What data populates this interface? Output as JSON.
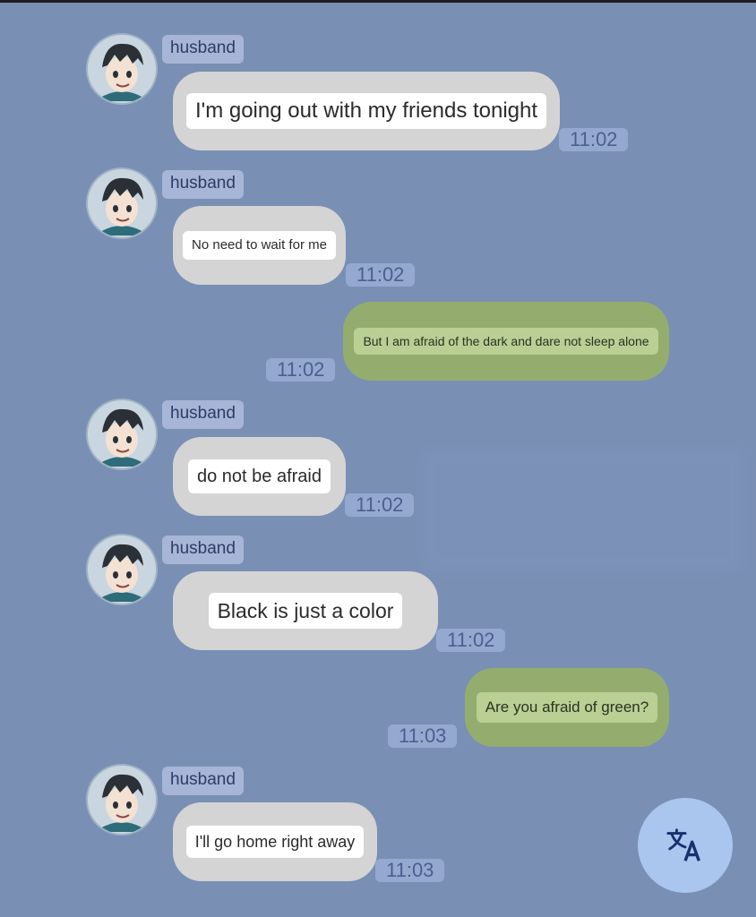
{
  "chat": {
    "messages": [
      {
        "sender": "husband",
        "direction": "in",
        "text": "I'm going out with my friends tonight",
        "time": "11:02"
      },
      {
        "sender": "husband",
        "direction": "in",
        "text": "No need to wait for me",
        "time": "11:02"
      },
      {
        "sender": "",
        "direction": "out",
        "text": "But I am afraid of the dark and dare not sleep alone",
        "time": "11:02"
      },
      {
        "sender": "husband",
        "direction": "in",
        "text": "do not be afraid",
        "time": "11:02"
      },
      {
        "sender": "husband",
        "direction": "in",
        "text": "Black is just a color",
        "time": "11:02"
      },
      {
        "sender": "",
        "direction": "out",
        "text": "Are you afraid of green?",
        "time": "11:03"
      },
      {
        "sender": "husband",
        "direction": "in",
        "text": "I'll go home right away",
        "time": "11:03"
      }
    ]
  },
  "fab": {
    "icon": "translate-icon"
  },
  "colors": {
    "background": "#7a8fb4",
    "incoming_bubble": "#d4d4d4",
    "outgoing_bubble": "#94ad6e",
    "fab": "#aac6ee"
  }
}
